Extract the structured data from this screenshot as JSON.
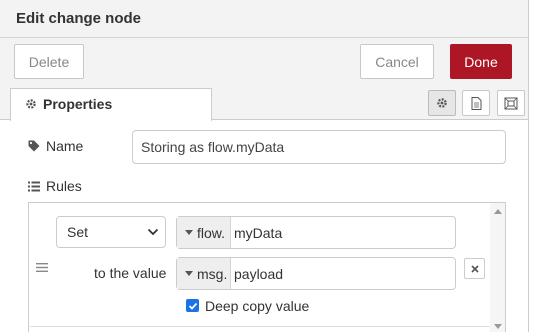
{
  "dialog": {
    "title": "Edit change node"
  },
  "toolbar": {
    "delete_label": "Delete",
    "cancel_label": "Cancel",
    "done_label": "Done"
  },
  "tabs": [
    {
      "label": "Properties",
      "icon": "gear-icon",
      "active": true
    }
  ],
  "tab_actions": [
    {
      "icon": "gear-icon",
      "selected": true
    },
    {
      "icon": "document-icon",
      "selected": false
    },
    {
      "icon": "appearance-icon",
      "selected": false
    }
  ],
  "form": {
    "name": {
      "label": "Name",
      "icon": "tag-icon",
      "value": "Storing as flow.myData"
    },
    "rules": {
      "label": "Rules",
      "icon": "list-icon"
    }
  },
  "rule": {
    "action": "Set",
    "target": {
      "type": "flow.",
      "value": "myData"
    },
    "to_label": "to the value",
    "source": {
      "type": "msg.",
      "value": "payload"
    },
    "deep_copy": {
      "label": "Deep copy value",
      "checked": true
    }
  },
  "colors": {
    "primary": "#ad1625",
    "checkbox": "#1a73e8",
    "header_bg": "#f3f3f3"
  }
}
